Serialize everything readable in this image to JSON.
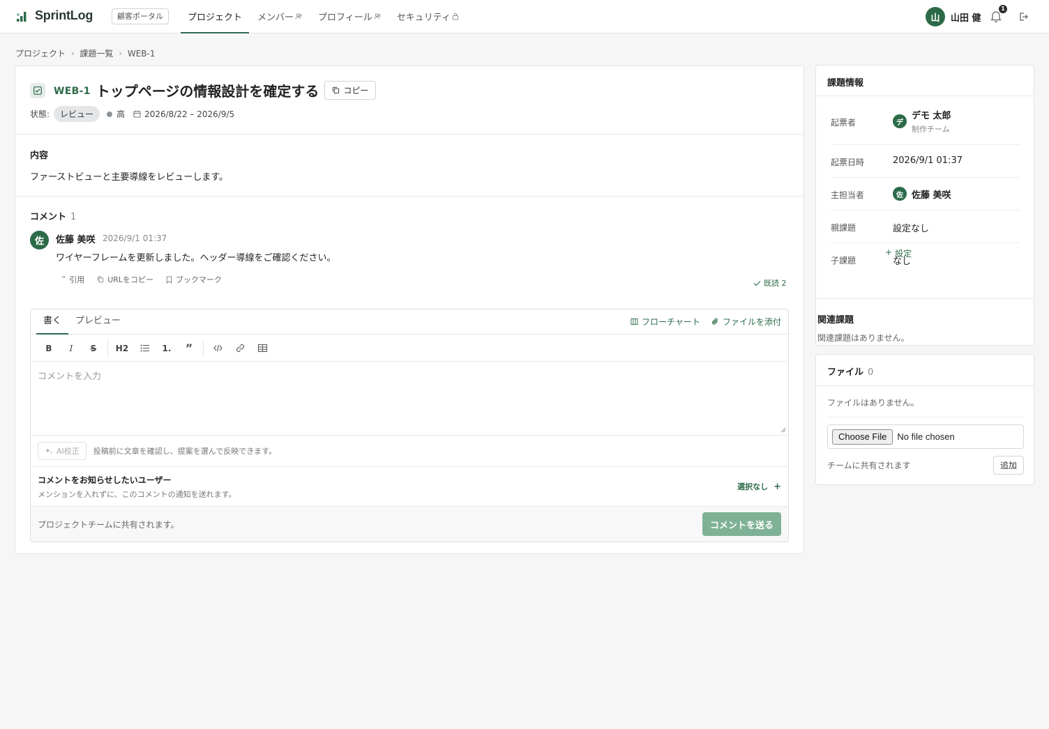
{
  "header": {
    "brand": "SprintLog",
    "portal_label": "顧客ポータル",
    "nav": [
      {
        "label": "プロジェクト",
        "active": true
      },
      {
        "label": "メンバー"
      },
      {
        "label": "プロフィール"
      },
      {
        "label": "セキュリティ"
      }
    ],
    "user_initial": "山",
    "user_name": "山田 健",
    "notification_count": "1"
  },
  "breadcrumb": [
    "プロジェクト",
    "課題一覧",
    "WEB-1"
  ],
  "issue": {
    "key": "WEB-1",
    "title": "トップページの情報設計を確定する",
    "copy_label": "コピー",
    "status_label": "状態:",
    "status": "レビュー",
    "priority": "高",
    "period": "2026/8/22 – 2026/9/5",
    "content_label": "内容",
    "content": "ファーストビューと主要導線をレビューします。"
  },
  "comments": {
    "label": "コメント",
    "count": "1",
    "items": [
      {
        "initial": "佐",
        "author": "佐藤 美咲",
        "time": "2026/9/1 01:37",
        "body": "ワイヤーフレームを更新しました。ヘッダー導線をご確認ください。",
        "actions": [
          "引用",
          "URLをコピー",
          "ブックマーク"
        ],
        "read": "既読 2"
      }
    ]
  },
  "editor": {
    "tabs": [
      "書く",
      "プレビュー"
    ],
    "flowchart_label": "フローチャート",
    "attach_label": "ファイルを添付",
    "toolbar": {
      "bold": "B",
      "italic": "I",
      "strike": "S",
      "heading": "H2",
      "ordered": "1.",
      "quote": "”"
    },
    "placeholder": "コメントを入力",
    "ai_label": "AI校正",
    "ai_hint": "投稿前に文章を確認し、提案を選んで反映できます。",
    "notify_title": "コメントをお知らせしたいユーザー",
    "notify_sub": "メンションを入れずに、このコメントの通知を送れます。",
    "notify_select": "選択なし",
    "footer_text": "プロジェクトチームに共有されます。",
    "send_label": "コメントを送る"
  },
  "side": {
    "title": "課題情報",
    "rows": {
      "reporter_label": "起票者",
      "reporter_initial": "デ",
      "reporter_name": "デモ 太郎",
      "reporter_team": "制作チーム",
      "created_label": "起票日時",
      "created": "2026/9/1 01:37",
      "assignee_label": "主担当者",
      "assignee_initial": "佐",
      "assignee_name": "佐藤 美咲",
      "parent_label": "親課題",
      "parent": "設定なし",
      "child_label": "子課題",
      "child": "なし"
    },
    "related_title": "関連課題",
    "related_set": "設定",
    "related_empty": "関連課題はありません。"
  },
  "files": {
    "title": "ファイル",
    "count": "0",
    "empty": "ファイルはありません。",
    "choose_label": "Choose File",
    "no_file": "No file chosen",
    "share_text": "チームに共有されます",
    "add_label": "追加"
  },
  "colors": {
    "accent": "#2d6b48",
    "send_disabled": "#7fb197"
  }
}
